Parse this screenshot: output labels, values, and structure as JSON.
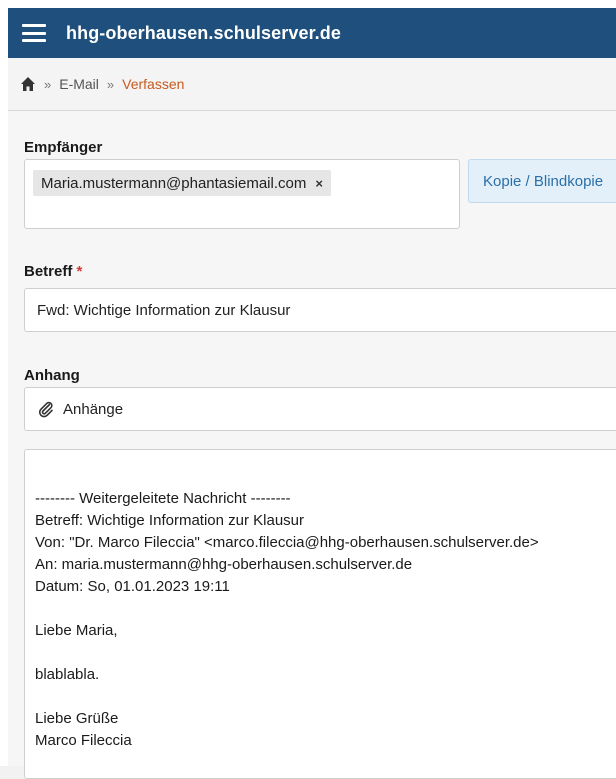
{
  "header": {
    "site_name": "hhg-oberhausen.schulserver.de"
  },
  "breadcrumb": {
    "separator": "»",
    "items": [
      "E-Mail"
    ],
    "current": "Verfassen"
  },
  "form": {
    "recipients_label": "Empfänger",
    "recipient_chip": "Maria.mustermann@phantasiemail.com",
    "chip_remove": "×",
    "cc_button": "Kopie / Blindkopie",
    "subject_label": "Betreff",
    "required_mark": "*",
    "subject_value": "Fwd: Wichtige Information zur Klausur",
    "attachment_label": "Anhang",
    "attachment_button": "Anhänge"
  },
  "message": {
    "lines": [
      "-------- Weitergeleitete Nachricht --------",
      "Betreff: Wichtige Information zur Klausur",
      "Von: \"Dr. Marco Fileccia\" <marco.fileccia@hhg-oberhausen.schulserver.de>",
      "An: maria.mustermann@hhg-oberhausen.schulserver.de",
      "Datum: So, 01.01.2023 19:11",
      "Liebe Maria,",
      "blablabla.",
      "Liebe Grüße",
      "Marco Fileccia"
    ]
  },
  "colors": {
    "header_bg": "#1e4f7d",
    "breadcrumb_current": "#c85a1e",
    "button_text": "#2a6fa8"
  }
}
